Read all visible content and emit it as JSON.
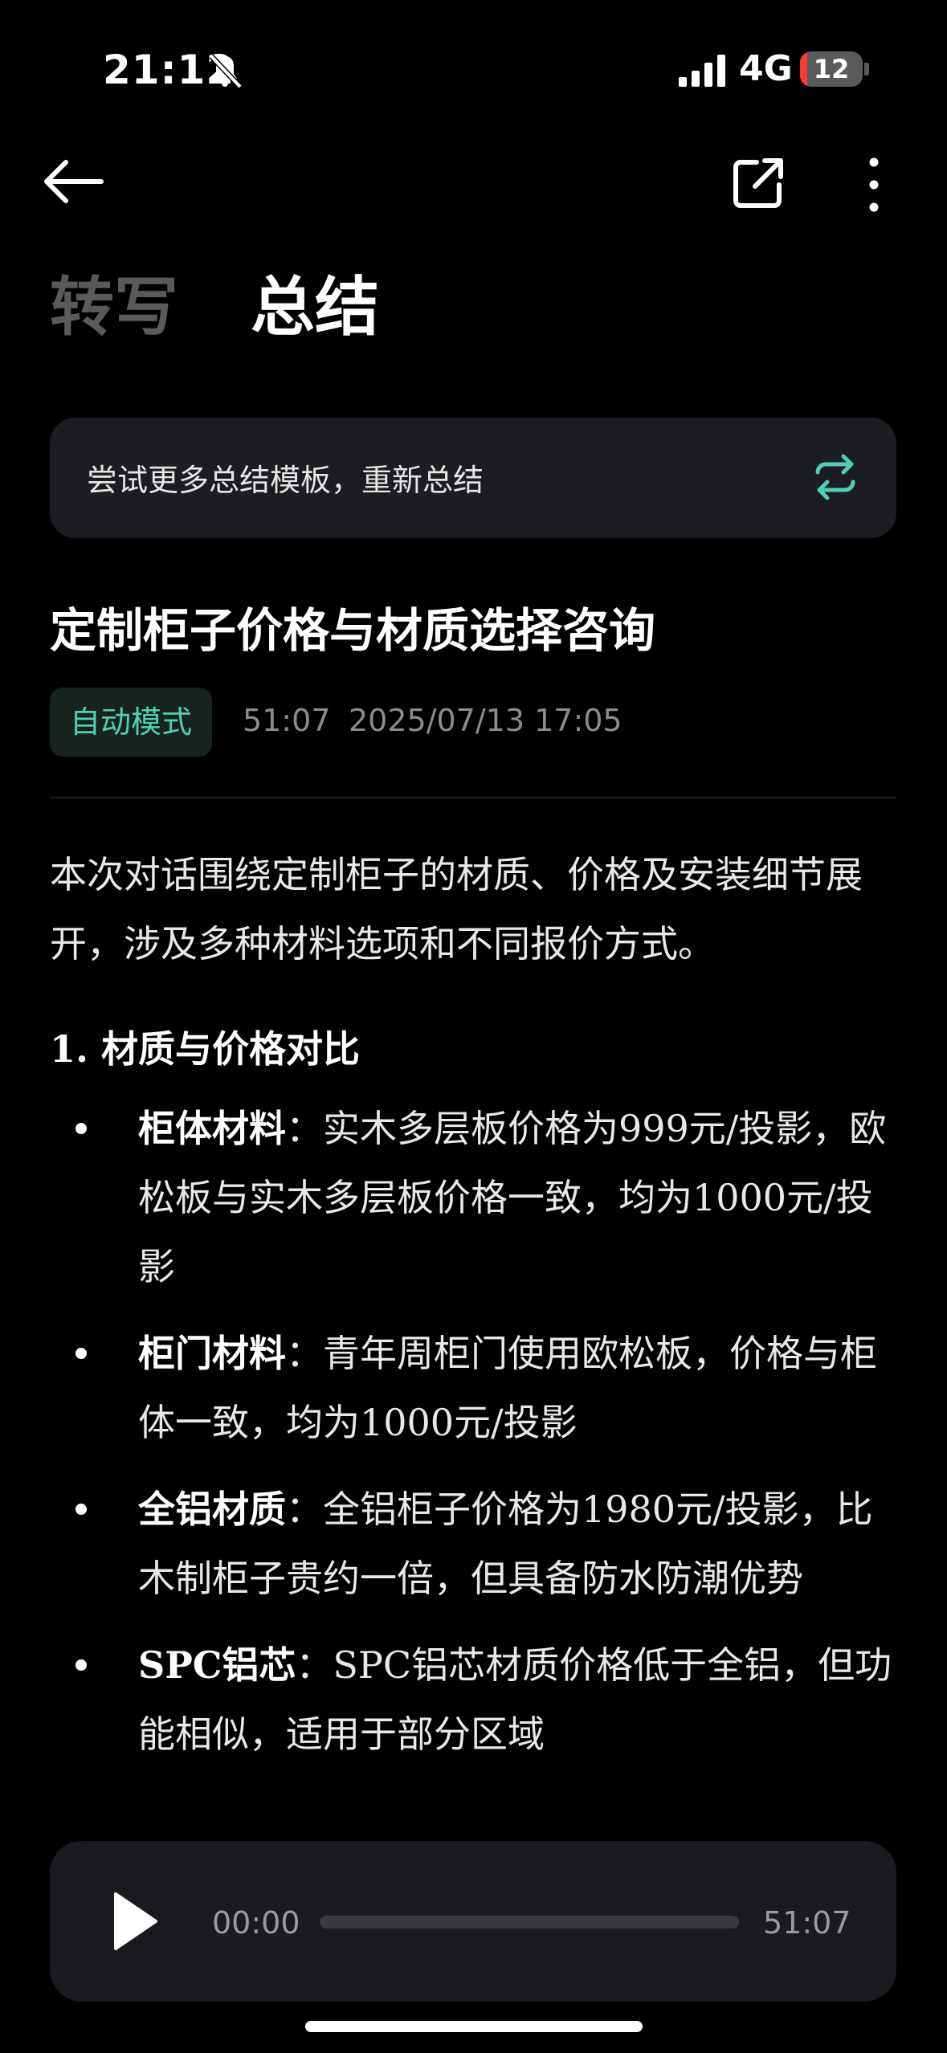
{
  "status_bar": {
    "time": "21:12",
    "network": "4G",
    "battery": "12",
    "battery_fraction": 0.12
  },
  "tabs": {
    "transcript": "转写",
    "summary": "总结"
  },
  "template_banner": {
    "text": "尝试更多总结模板，重新总结"
  },
  "record": {
    "title": "定制柜子价格与材质选择咨询",
    "mode": "自动模式",
    "duration": "51:07",
    "datetime": "2025/07/13 17:05"
  },
  "summary": {
    "intro": "本次对话围绕定制柜子的材质、价格及安装细节展开，涉及多种材料选项和不同报价方式。",
    "section_heading": "1. 材质与价格对比",
    "bullets": [
      {
        "label": "柜体材料",
        "sep": "：",
        "text": "实木多层板价格为999元/投影，欧松板与实木多层板价格一致，均为1000元/投影"
      },
      {
        "label": "柜门材料",
        "sep": "：",
        "text": "青年周柜门使用欧松板，价格与柜体一致，均为1000元/投影"
      },
      {
        "label": "全铝材质",
        "sep": "：",
        "text": "全铝柜子价格为1980元/投影，比木制柜子贵约一倍，但具备防水防潮优势"
      },
      {
        "label": "SPC铝芯",
        "sep": "：",
        "text": "SPC铝芯材质价格低于全铝，但功能相似，适用于部分区域"
      }
    ]
  },
  "player": {
    "current": "00:00",
    "total": "51:07",
    "progress": 0
  },
  "colors": {
    "accent": "#4fd0b6",
    "background": "#000000",
    "card": "#1c1d20"
  },
  "icons": [
    "bell-slash-icon",
    "signal-icon",
    "battery-icon",
    "back-arrow-icon",
    "share-icon",
    "more-icon",
    "refresh-icon",
    "play-icon"
  ]
}
